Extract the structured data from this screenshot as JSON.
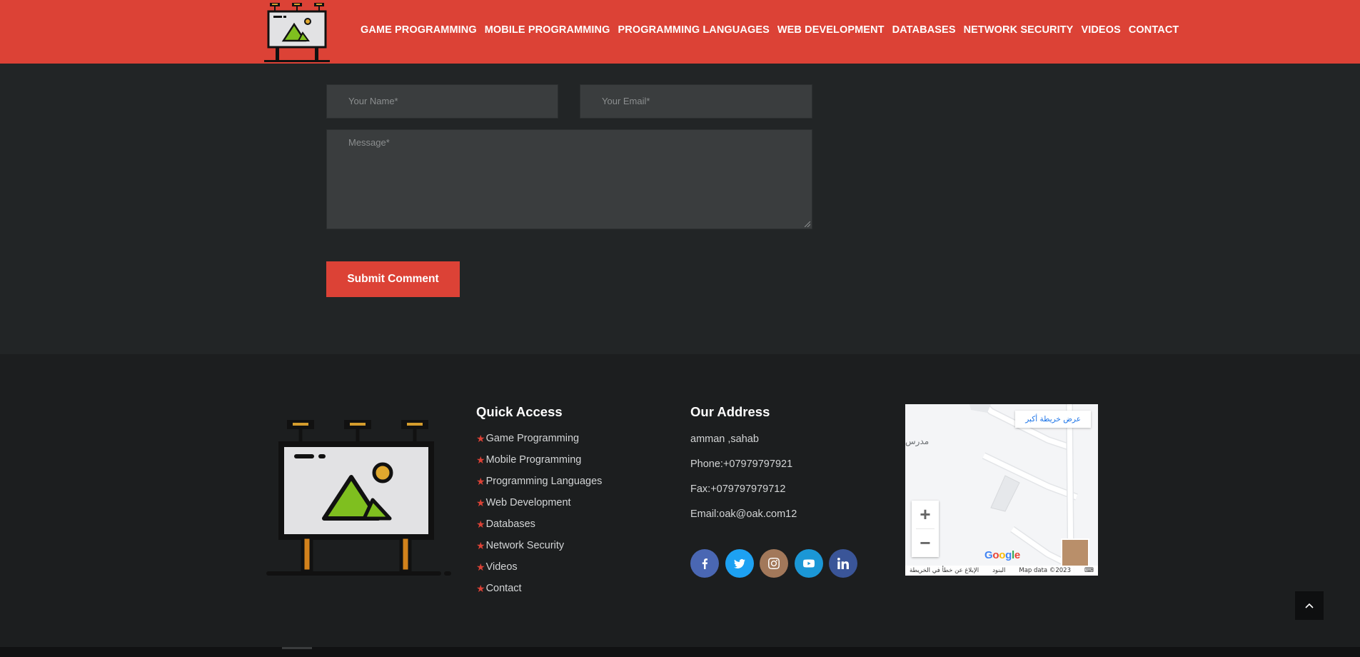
{
  "header": {
    "nav": [
      {
        "label": "GAME PROGRAMMING"
      },
      {
        "label": "MOBILE PROGRAMMING"
      },
      {
        "label": "PROGRAMMING LANGUAGES"
      },
      {
        "label": "WEB DEVELOPMENT"
      },
      {
        "label": "DATABASES"
      },
      {
        "label": "NETWORK SECURITY"
      },
      {
        "label": "VIDEOS"
      },
      {
        "label": "CONTACT"
      }
    ]
  },
  "form": {
    "name_placeholder": "Your Name*",
    "email_placeholder": "Your Email*",
    "message_placeholder": "Message*",
    "submit_label": "Submit Comment"
  },
  "footer": {
    "quick_access": {
      "title": "Quick Access",
      "items": [
        "Game Programming",
        "Mobile Programming",
        "Programming Languages",
        "Web Development",
        "Databases",
        "Network Security",
        "Videos",
        "Contact"
      ]
    },
    "address": {
      "title": "Our Address",
      "line1": "amman ,sahab",
      "phone": "Phone:+07979797921",
      "fax": "Fax:+079797979712",
      "email": "Email:oak@oak.com12"
    },
    "socials": [
      {
        "name": "facebook",
        "color": "#4a67b3"
      },
      {
        "name": "twitter",
        "color": "#1da1f2"
      },
      {
        "name": "instagram",
        "color": "#a2785a"
      },
      {
        "name": "youtube",
        "color": "#1b97d6"
      },
      {
        "name": "linkedin",
        "color": "#3a5598"
      }
    ],
    "map": {
      "bigger_map": "عرض خريطة أكبر",
      "place_label": "مدرس",
      "google": "Google",
      "attrib_report": "الإبلاغ عن خطأ في الخريطة",
      "attrib_terms": "البنود",
      "attrib_data": "Map data ©2023"
    }
  },
  "colors": {
    "accent": "#dc4236",
    "dark_bg": "#222526",
    "footer_bg": "#1c1e1f"
  }
}
